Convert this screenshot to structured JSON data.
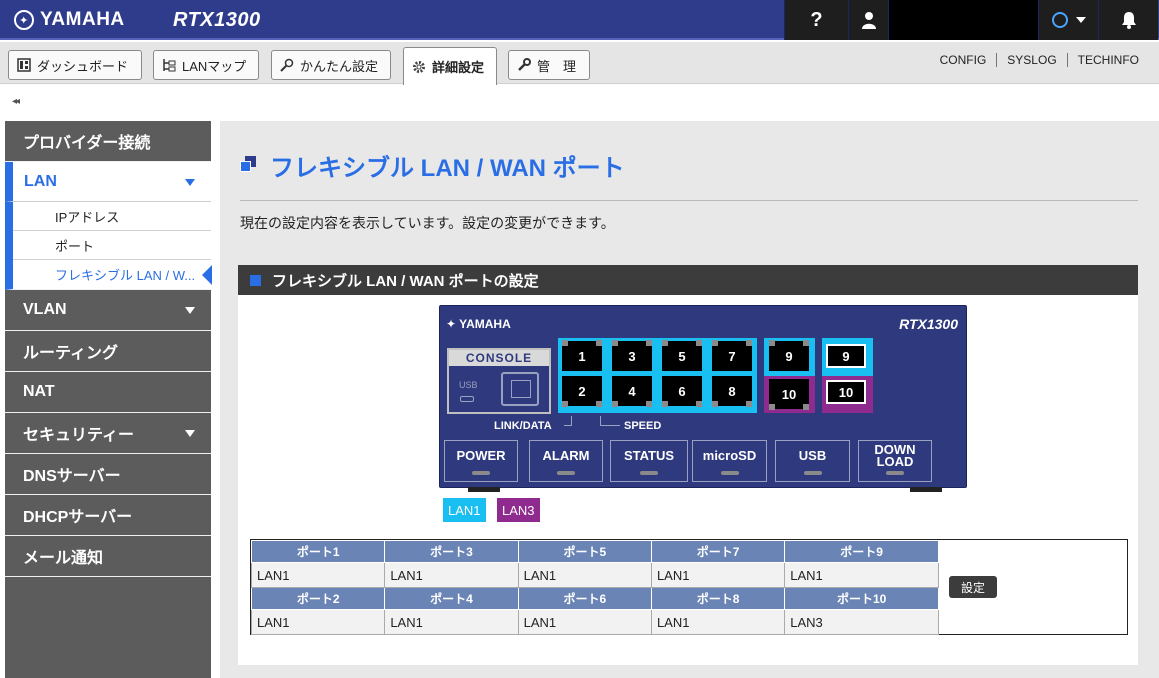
{
  "header": {
    "brand": "YAMAHA",
    "model": "RTX1300",
    "help_label": "?"
  },
  "tabs": [
    {
      "label": "ダッシュボード",
      "icon": "dashboard-icon"
    },
    {
      "label": "LANマップ",
      "icon": "lan-map-icon"
    },
    {
      "label": "かんたん設定",
      "icon": "wand-icon"
    },
    {
      "label": "詳細設定",
      "icon": "gear-icon",
      "active": true
    },
    {
      "label": "管　理",
      "icon": "wrench-icon"
    }
  ],
  "top_links": [
    "CONFIG",
    "SYSLOG",
    "TECHINFO"
  ],
  "collapse_label": "◂◂",
  "sidebar": {
    "items": [
      {
        "label": "プロバイダー接続"
      },
      {
        "label": "LAN",
        "expanded": true
      },
      {
        "label": "VLAN"
      },
      {
        "label": "ルーティング"
      },
      {
        "label": "NAT"
      },
      {
        "label": "セキュリティー"
      },
      {
        "label": "DNSサーバー"
      },
      {
        "label": "DHCPサーバー"
      },
      {
        "label": "メール通知"
      }
    ],
    "lan_sub": [
      {
        "label": "IPアドレス"
      },
      {
        "label": "ポート"
      },
      {
        "label": "フレキシブル LAN / W...",
        "current": true
      }
    ]
  },
  "main": {
    "title": "フレキシブル LAN / WAN ポート",
    "description": "現在の設定内容を表示しています。設定の変更ができます。",
    "panel_title": "フレキシブル LAN / WAN ポートの設定"
  },
  "device": {
    "brand": "YAMAHA",
    "model": "RTX1300",
    "console_label": "CONSOLE",
    "usb_mini_label": "USB",
    "link_label": "LINK/DATA",
    "speed_label": "SPEED",
    "ports_top": [
      "1",
      "3",
      "5",
      "7",
      "9"
    ],
    "ports_bottom": [
      "2",
      "4",
      "6",
      "8",
      "10"
    ],
    "sfp_top": "9",
    "sfp_bottom": "10",
    "leds": [
      "POWER",
      "ALARM",
      "STATUS",
      "microSD",
      "USB",
      "DOWN LOAD"
    ]
  },
  "legend": {
    "lan1": "LAN1",
    "lan3": "LAN3",
    "lan1_color": "#18bff0",
    "lan3_color": "#8f2a8f"
  },
  "port_table": {
    "row1_headers": [
      "ポート1",
      "ポート3",
      "ポート5",
      "ポート7",
      "ポート9"
    ],
    "row1_values": [
      "LAN1",
      "LAN1",
      "LAN1",
      "LAN1",
      "LAN1"
    ],
    "row2_headers": [
      "ポート2",
      "ポート4",
      "ポート6",
      "ポート8",
      "ポート10"
    ],
    "row2_values": [
      "LAN1",
      "LAN1",
      "LAN1",
      "LAN1",
      "LAN3"
    ],
    "set_label": "設定"
  }
}
